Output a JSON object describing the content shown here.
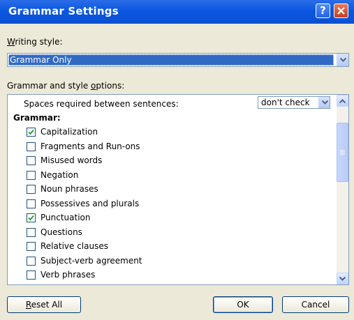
{
  "window": {
    "title": "Grammar Settings",
    "help_glyph": "?",
    "close_glyph": "✕"
  },
  "writing_style": {
    "label_u": "W",
    "label_rest": "riting style:",
    "value": "Grammar Only"
  },
  "options": {
    "label_pre": "Grammar and style ",
    "label_u": "o",
    "label_post": "ptions:",
    "spaces_label": "Spaces required between sentences:",
    "spaces_value": "don't check",
    "section_header": "Grammar:",
    "items": [
      {
        "label": "Capitalization",
        "checked": true
      },
      {
        "label": "Fragments and Run-ons",
        "checked": false
      },
      {
        "label": "Misused words",
        "checked": false
      },
      {
        "label": "Negation",
        "checked": false
      },
      {
        "label": "Noun phrases",
        "checked": false
      },
      {
        "label": "Possessives and plurals",
        "checked": false
      },
      {
        "label": "Punctuation",
        "checked": true
      },
      {
        "label": "Questions",
        "checked": false
      },
      {
        "label": "Relative clauses",
        "checked": false
      },
      {
        "label": "Subject-verb agreement",
        "checked": false
      },
      {
        "label": "Verb phrases",
        "checked": false
      }
    ]
  },
  "buttons": {
    "reset_u": "R",
    "reset_rest": "eset All",
    "ok": "OK",
    "cancel": "Cancel"
  },
  "colors": {
    "titlebar": "#0b57e0",
    "selection": "#316ac5",
    "check": "#21a121"
  }
}
